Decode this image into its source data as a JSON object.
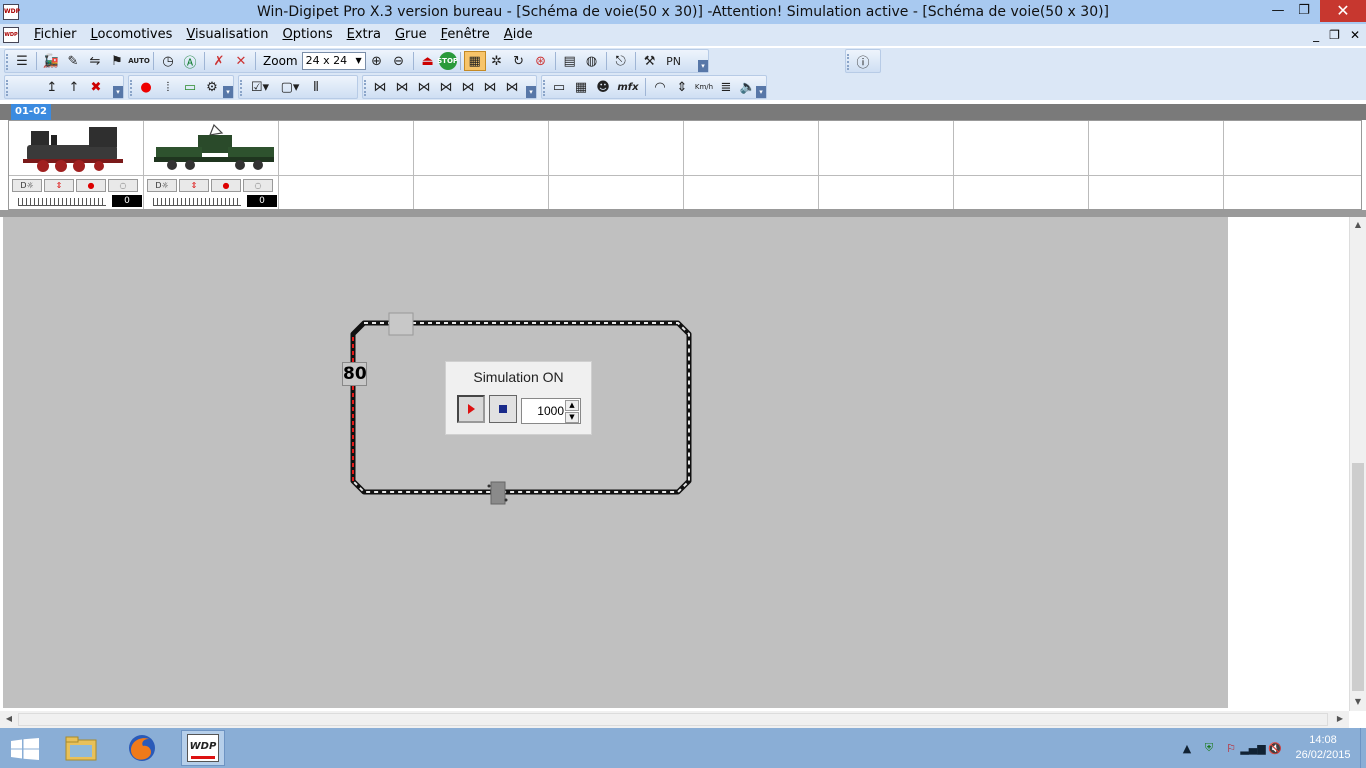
{
  "window": {
    "title": "Win-Digipet Pro X.3 version bureau  - [Schéma de voie(50 x 30)] -Attention! Simulation active - [Schéma de voie(50 x 30)]",
    "minimize": "—",
    "maximize": "❐",
    "close": "✕"
  },
  "menu": {
    "items": [
      {
        "u": "F",
        "rest": "ichier"
      },
      {
        "u": "L",
        "rest": "ocomotives"
      },
      {
        "u": "V",
        "rest": "isualisation"
      },
      {
        "u": "O",
        "rest": "ptions"
      },
      {
        "u": "E",
        "rest": "xtra"
      },
      {
        "u": "G",
        "rest": "rue"
      },
      {
        "u": "F",
        "rest": "enêtre"
      },
      {
        "u": "A",
        "rest": "ide"
      }
    ],
    "mdi_minimize": "_",
    "mdi_restore": "❐",
    "mdi_close": "✕"
  },
  "toolbar": {
    "zoom_label": "Zoom",
    "zoom_value": "24 x 24",
    "pn_label": "PN",
    "mfx_label": "mfx",
    "kmh_label": "Km/h",
    "stop_label": "STOP",
    "auto_label": "AUTO"
  },
  "locos": {
    "tab_label": "01-02",
    "slots": [
      {
        "speed": "0"
      },
      {
        "speed": "0"
      }
    ]
  },
  "layout": {
    "block_label": "80",
    "simulation": {
      "title": "Simulation ON",
      "interval": "1000"
    }
  },
  "taskbar": {
    "wdp_label": "WDP",
    "time": "14:08",
    "date": "26/02/2015"
  },
  "colors": {
    "titlebar": "#a8c9f0",
    "menubar": "#dbe7f6",
    "canvas": "#c0c0c0",
    "taskbar": "#8aaed6",
    "track_occupied": "#e41b1b"
  }
}
